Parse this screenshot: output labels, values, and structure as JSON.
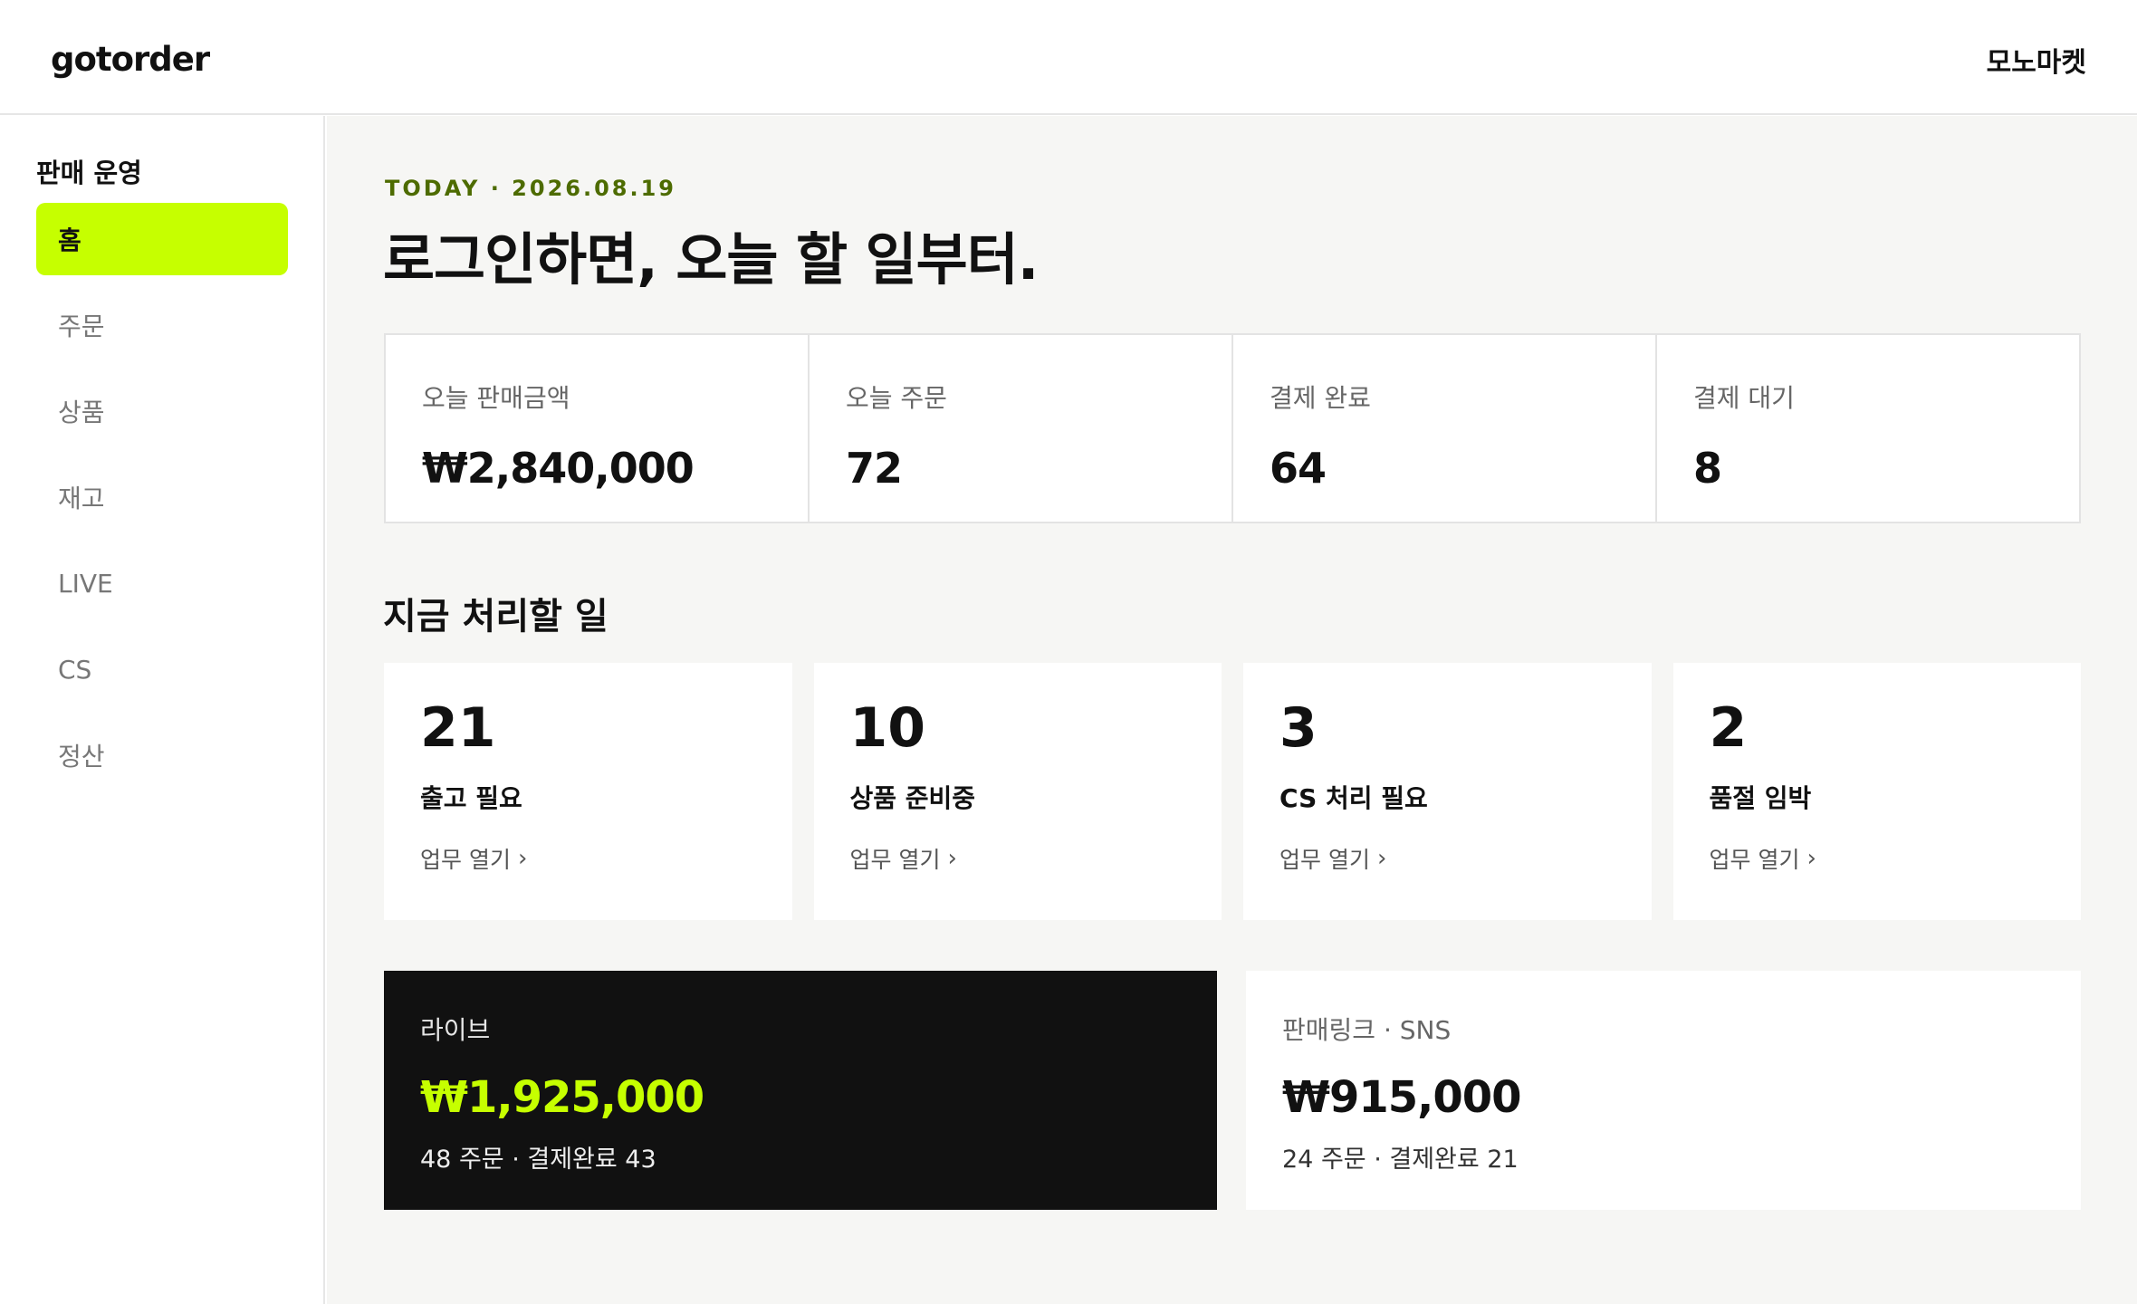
{
  "header": {
    "logo": "gotorder",
    "store_name": "모노마켓"
  },
  "sidebar": {
    "section_title": "판매 운영",
    "items": [
      {
        "label": "홈",
        "active": true
      },
      {
        "label": "주문",
        "active": false
      },
      {
        "label": "상품",
        "active": false
      },
      {
        "label": "재고",
        "active": false
      },
      {
        "label": "LIVE",
        "active": false
      },
      {
        "label": "CS",
        "active": false
      },
      {
        "label": "정산",
        "active": false
      }
    ]
  },
  "main": {
    "date_line": "TODAY · 2026.08.19",
    "headline": "로그인하면, 오늘 할 일부터.",
    "stats": [
      {
        "label": "오늘 판매금액",
        "value": "₩2,840,000"
      },
      {
        "label": "오늘 주문",
        "value": "72"
      },
      {
        "label": "결제 완료",
        "value": "64"
      },
      {
        "label": "결제 대기",
        "value": "8"
      }
    ],
    "tasks_title": "지금 처리할 일",
    "tasks": [
      {
        "count": "21",
        "name": "출고 필요",
        "link": "업무 열기"
      },
      {
        "count": "10",
        "name": "상품 준비중",
        "link": "업무 열기"
      },
      {
        "count": "3",
        "name": "CS 처리 필요",
        "link": "업무 열기"
      },
      {
        "count": "2",
        "name": "품절 임박",
        "link": "업무 열기"
      }
    ],
    "channels": {
      "live": {
        "label": "라이브",
        "amount": "₩1,925,000",
        "summary": "48 주문 · 결제완료 43"
      },
      "link": {
        "label": "판매링크 · SNS",
        "amount": "₩915,000",
        "summary": "24 주문 · 결제완료 21"
      }
    }
  },
  "colors": {
    "accent": "#c6ff00",
    "date_text": "#4d6b00",
    "dark_card": "#111111",
    "main_bg": "#f6f6f4"
  },
  "icons": {
    "task_link": "chevron-right-icon"
  }
}
